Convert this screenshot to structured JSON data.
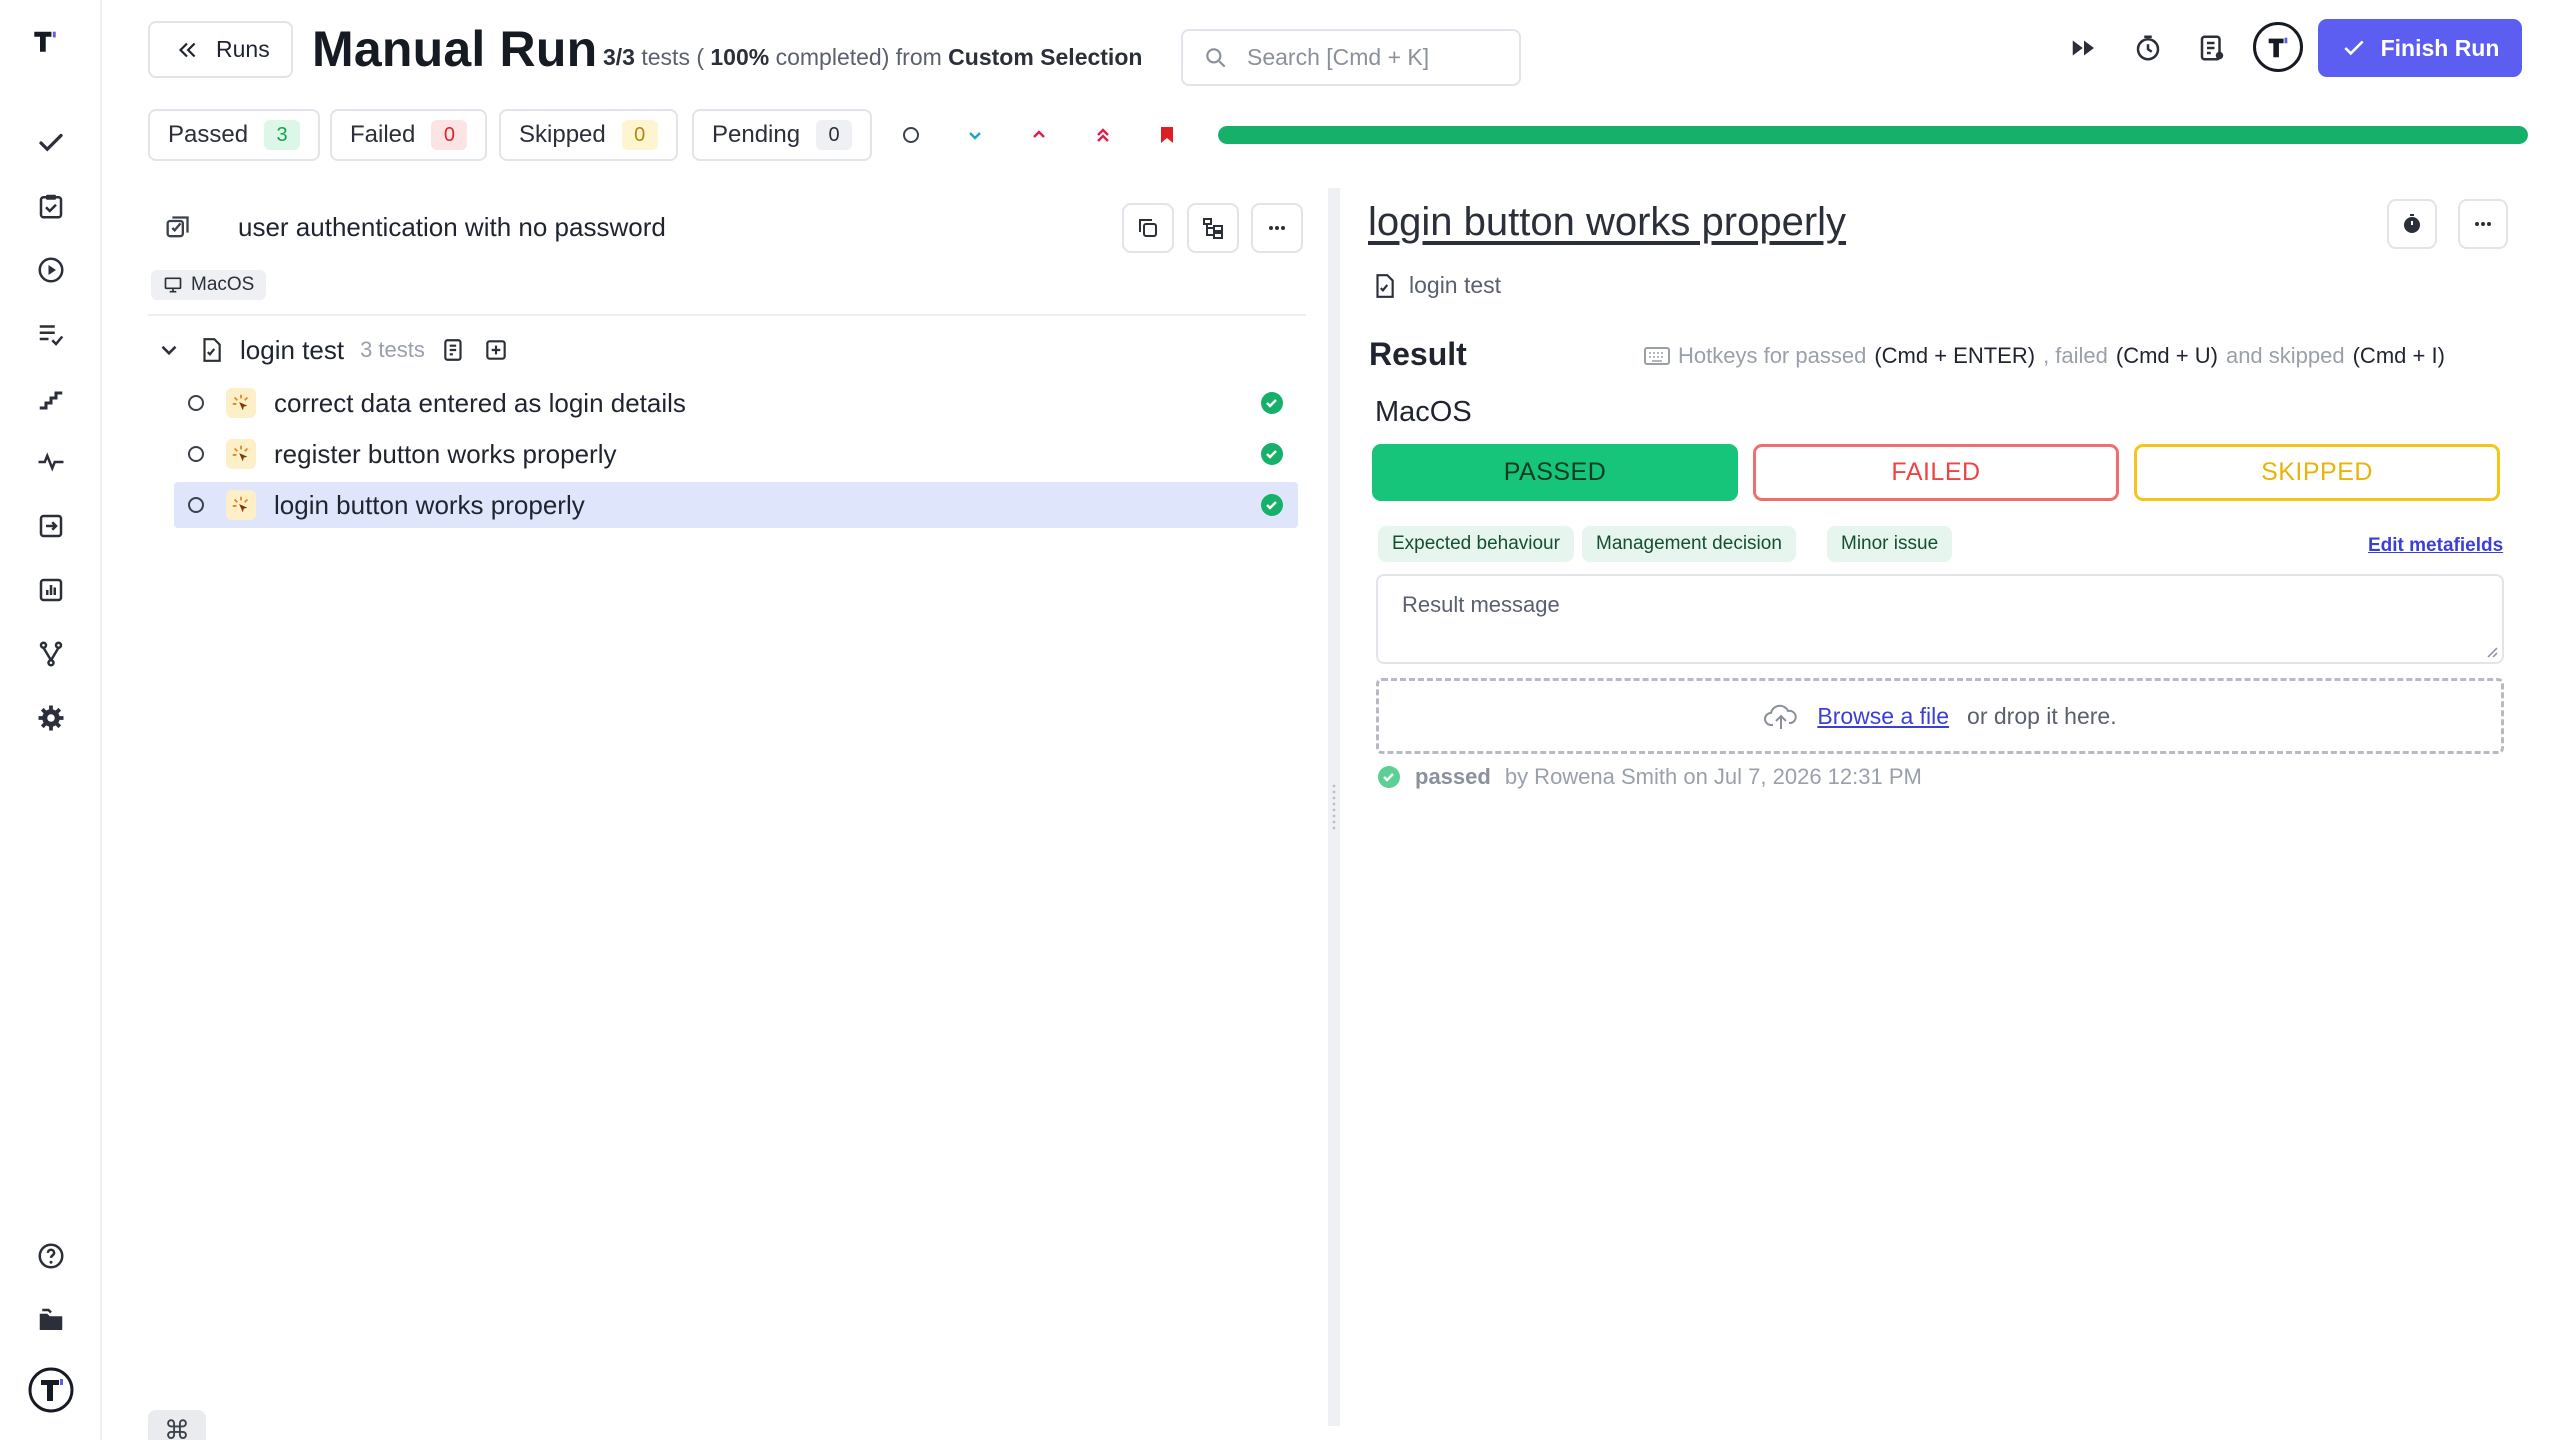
{
  "header": {
    "back_label": "Runs",
    "title": "Manual Run",
    "subtitle": {
      "count": "3/3",
      "tests_word": "tests (",
      "percent": "100%",
      "completed_from": "completed) from",
      "source": "Custom Selection"
    },
    "search_placeholder": "Search [Cmd + K]",
    "finish_label": "Finish Run",
    "accent_color": "#5b5ef0"
  },
  "filters": [
    {
      "label": "Passed",
      "count": "3"
    },
    {
      "label": "Failed",
      "count": "0"
    },
    {
      "label": "Skipped",
      "count": "0"
    },
    {
      "label": "Pending",
      "count": "0"
    }
  ],
  "progress": {
    "fraction": 1.0,
    "color": "#16b06a"
  },
  "suite": {
    "title": "user authentication with no password",
    "environment_tag": "MacOS",
    "group": {
      "name": "login test",
      "count_label": "3 tests"
    },
    "tests": [
      {
        "name": "correct data entered as login details",
        "status": "passed",
        "selected": false
      },
      {
        "name": "register button works properly",
        "status": "passed",
        "selected": false
      },
      {
        "name": "login button works properly",
        "status": "passed",
        "selected": true
      }
    ]
  },
  "detail": {
    "title": "login button works properly",
    "parent": "login test",
    "result_heading": "Result",
    "hotkeys": {
      "prefix": "Hotkeys for passed",
      "passed_key": "(Cmd + ENTER)",
      "failed_word": ", failed",
      "failed_key": "(Cmd + U)",
      "skipped_word": "and skipped",
      "skipped_key": "(Cmd + I)"
    },
    "environment": "MacOS",
    "buttons": {
      "passed": "PASSED",
      "failed": "FAILED",
      "skipped": "SKIPPED"
    },
    "chips": [
      "Expected behaviour",
      "Management decision",
      "Minor issue"
    ],
    "edit_metafields": "Edit metafields",
    "message_placeholder": "Result message",
    "upload": {
      "browse": "Browse a file",
      "rest": "or drop it here."
    },
    "history": {
      "status": "passed",
      "rest": "by Rowena Smith on Jul 7, 2026 12:31 PM"
    }
  },
  "footer": {
    "cmd_key": "⌘"
  }
}
